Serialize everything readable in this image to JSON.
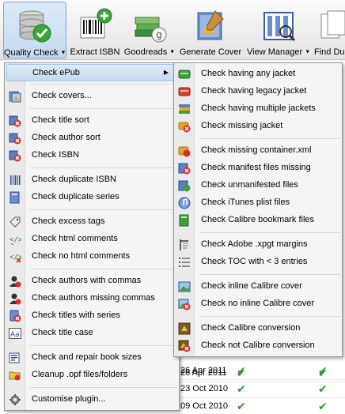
{
  "toolbar": {
    "quality_check": "Quality Check",
    "extract_isbn": "Extract ISBN",
    "goodreads": "Goodreads",
    "generate_cover": "Generate Cover",
    "view_manager": "View Manager",
    "find_duplicates": "Find Dup"
  },
  "background_table": {
    "rows": [
      {
        "date": "26 Apr 2011"
      },
      {
        "date": "26 Apr 2011"
      },
      {
        "date": "23 Oct 2010"
      },
      {
        "date": "09 Oct 2010"
      }
    ]
  },
  "main_menu": {
    "items": [
      {
        "label": "Check ePub",
        "icon": "none"
      },
      {
        "label": "Check covers...",
        "icon": "covers-icon"
      },
      {
        "label": "Check title sort",
        "icon": "sort-icon"
      },
      {
        "label": "Check author sort",
        "icon": "sort-icon"
      },
      {
        "label": "Check ISBN",
        "icon": "isbn-icon"
      },
      {
        "label": "Check duplicate ISBN",
        "icon": "barcode-icon"
      },
      {
        "label": "Check duplicate series",
        "icon": "series-icon"
      },
      {
        "label": "Check excess tags",
        "icon": "tag-icon"
      },
      {
        "label": "Check html comments",
        "icon": "html-comment-icon"
      },
      {
        "label": "Check no html comments",
        "icon": "no-html-comment-icon"
      },
      {
        "label": "Check authors with commas",
        "icon": "author-icon"
      },
      {
        "label": "Check authors missing commas",
        "icon": "author-missing-icon"
      },
      {
        "label": "Check titles with series",
        "icon": "titles-series-icon"
      },
      {
        "label": "Check title case",
        "icon": "title-case-icon"
      },
      {
        "label": "Check and repair book sizes",
        "icon": "book-sizes-icon"
      },
      {
        "label": "Cleanup .opf files/folders",
        "icon": "folder-cleanup-icon"
      },
      {
        "label": "Customise plugin...",
        "icon": "gear-icon"
      }
    ]
  },
  "sub_menu": {
    "items": [
      {
        "label": "Check having any jacket"
      },
      {
        "label": "Check having legacy jacket"
      },
      {
        "label": "Check having multiple jackets"
      },
      {
        "label": "Check missing jacket"
      },
      {
        "label": "Check missing container.xml"
      },
      {
        "label": "Check manifest files missing"
      },
      {
        "label": "Check unmanifested files"
      },
      {
        "label": "Check iTunes plist files"
      },
      {
        "label": "Check Calibre bookmark files"
      },
      {
        "label": "Check Adobe .xpgt margins"
      },
      {
        "label": "Check TOC with < 3 entries"
      },
      {
        "label": "Check inline Calibre cover"
      },
      {
        "label": "Check no inline Calibre cover"
      },
      {
        "label": "Check Calibre conversion"
      },
      {
        "label": "Check not Calibre conversion"
      }
    ]
  },
  "colors": {
    "accent_green": "#2e9b2e",
    "highlight_blue": "#c5d9f1",
    "error_red": "#d9302c"
  }
}
